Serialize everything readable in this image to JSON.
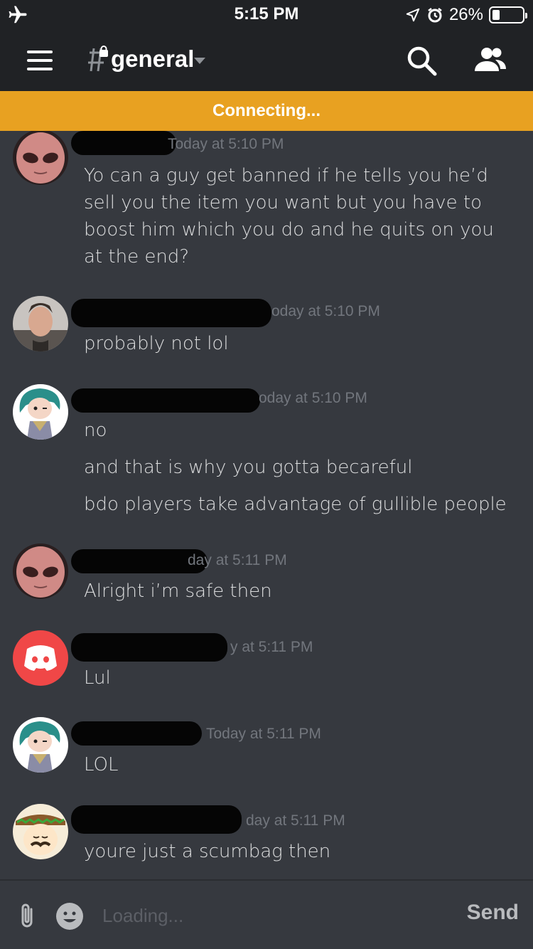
{
  "status_bar": {
    "time": "5:15 PM",
    "battery_percent": "26%",
    "battery_level": 0.26,
    "icons": [
      "airplane-icon",
      "location-icon",
      "alarm-icon",
      "battery-icon"
    ]
  },
  "header": {
    "channel": "general",
    "icons": [
      "menu-icon",
      "locked-channel-icon",
      "chevron-down-icon",
      "search-icon",
      "members-icon"
    ]
  },
  "banner": {
    "text": "Connecting..."
  },
  "messages": [
    {
      "timestamp": "Today at 5:10 PM",
      "lines": [
        "Yo can a guy get banned if he tells you he’d sell you the item you want but you have to boost him which you do and he quits on you at the end?"
      ]
    },
    {
      "timestamp": "oday at 5:10 PM",
      "lines": [
        "probably not lol"
      ]
    },
    {
      "timestamp": "oday at 5:10 PM",
      "lines": [
        "no",
        "and that is why you gotta becareful",
        "bdo players take advantage of gullible people"
      ]
    },
    {
      "timestamp": "day at 5:11 PM",
      "lines": [
        "Alright i’m safe then"
      ]
    },
    {
      "timestamp": "y at 5:11 PM",
      "lines": [
        "Lul"
      ]
    },
    {
      "timestamp": "Today at 5:11 PM",
      "lines": [
        "LOL"
      ]
    },
    {
      "timestamp": "day at 5:11 PM",
      "lines": [
        "youre just a scumbag then"
      ]
    }
  ],
  "input": {
    "placeholder": "Loading...",
    "send_label": "Send"
  },
  "colors": {
    "background": "#36393f",
    "header": "#202225",
    "banner": "#e8a121",
    "discord_red": "#f04747"
  }
}
